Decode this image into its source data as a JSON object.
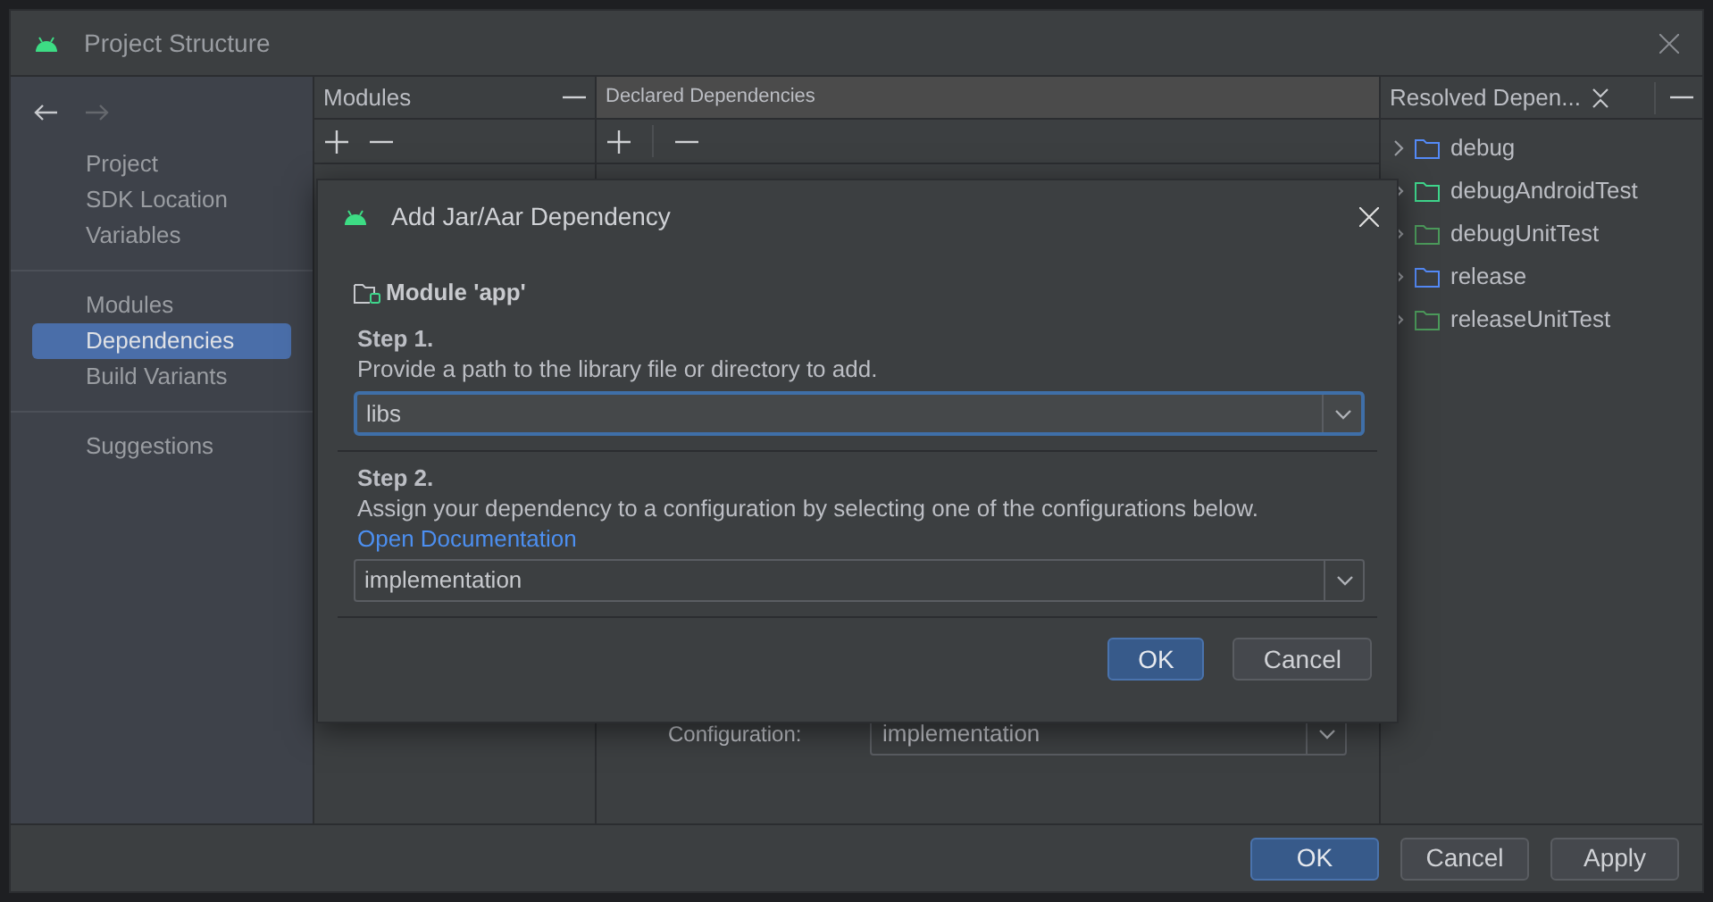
{
  "window": {
    "title": "Project Structure"
  },
  "sidebar": {
    "groups": [
      [
        {
          "label": "Project",
          "selected": false
        },
        {
          "label": "SDK Location",
          "selected": false
        },
        {
          "label": "Variables",
          "selected": false
        }
      ],
      [
        {
          "label": "Modules",
          "selected": false
        },
        {
          "label": "Dependencies",
          "selected": true
        },
        {
          "label": "Build Variants",
          "selected": false
        }
      ],
      [
        {
          "label": "Suggestions",
          "selected": false
        }
      ]
    ]
  },
  "modules_panel": {
    "title": "Modules"
  },
  "declared_panel": {
    "title": "Declared Dependencies",
    "configuration_label": "Configuration:",
    "configuration_value": "implementation"
  },
  "resolved_panel": {
    "title": "Resolved Depen...",
    "items": [
      {
        "label": "debug",
        "color": "#548af7"
      },
      {
        "label": "debugAndroidTest",
        "color": "#3fd68c"
      },
      {
        "label": "debugUnitTest",
        "color": "#4c9a5b"
      },
      {
        "label": "release",
        "color": "#548af7"
      },
      {
        "label": "releaseUnitTest",
        "color": "#4c9a5b"
      }
    ]
  },
  "dialog": {
    "title": "Add Jar/Aar Dependency",
    "module": "Module 'app'",
    "step1_title": "Step 1.",
    "step1_text": "Provide a path to the library file or directory to add.",
    "path_value": "libs",
    "step2_title": "Step 2.",
    "step2_text": "Assign your dependency to a configuration by selecting one of the configurations below.",
    "doc_link": "Open Documentation",
    "configuration_value": "implementation",
    "buttons": [
      {
        "label": "OK",
        "kind": "primary"
      },
      {
        "label": "Cancel",
        "kind": "secondary"
      }
    ]
  },
  "footer": {
    "buttons": [
      {
        "label": "OK",
        "kind": "primary"
      },
      {
        "label": "Cancel",
        "kind": "secondary"
      },
      {
        "label": "Apply",
        "kind": "secondary"
      }
    ]
  }
}
